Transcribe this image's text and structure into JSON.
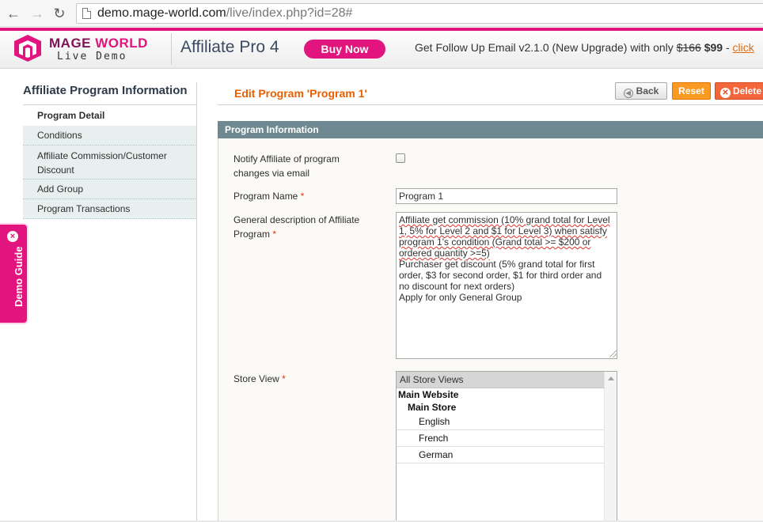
{
  "browser": {
    "url_host": "demo.mage-world.com",
    "url_path": "/live/index.php?id=28#"
  },
  "demo_header": {
    "logo_word1": "MAGE",
    "logo_word2": "WORLD",
    "logo_sub": "Live Demo",
    "product": "Affiliate Pro 4",
    "buy_now": "Buy Now",
    "promo_text": "Get Follow Up Email v2.1.0 (New Upgrade) with only ",
    "promo_old_price": "$166",
    "promo_new_price": "$99",
    "promo_sep": " - ",
    "promo_link": "click",
    "brand_color": "#e2147d"
  },
  "demo_guide": {
    "label": "Demo Guide",
    "close": "×"
  },
  "sidebar": {
    "title": "Affiliate Program Information",
    "items": [
      {
        "label": "Program Detail"
      },
      {
        "label": "Conditions"
      },
      {
        "label": "Affiliate Commission/Customer Discount"
      },
      {
        "label": "Add Group"
      },
      {
        "label": "Program Transactions"
      }
    ]
  },
  "main": {
    "heading": "Edit Program 'Program 1'",
    "buttons": {
      "back": "Back",
      "reset": "Reset",
      "delete": "Delete"
    },
    "section_title": "Program Information",
    "fields": {
      "notify_label_1": "Notify Affiliate of program",
      "notify_label_2": "changes via email",
      "notify_checked": false,
      "name_label": "Program Name",
      "name_value": "Program 1",
      "desc_label_1": "General description of Affiliate",
      "desc_label_2": "Program",
      "desc_lines": [
        "Affiliate get commission (10% grand total for Level",
        "1, 5% for Level 2 and $1 for Level 3) when satisfy",
        "program 1's condition (Grand total >= $200 or",
        "ordered quantity >=5)",
        "Purchaser get discount (5% grand total for first",
        "order, $3 for second order, $1 for third order and",
        "no discount for next orders)",
        "Apply for only General Group"
      ],
      "store_label": "Store View",
      "required_mark": "*",
      "store_options": {
        "all": "All Store Views",
        "website": "Main Website",
        "store": "Main Store",
        "views": [
          "English",
          "French",
          "German"
        ]
      }
    }
  }
}
